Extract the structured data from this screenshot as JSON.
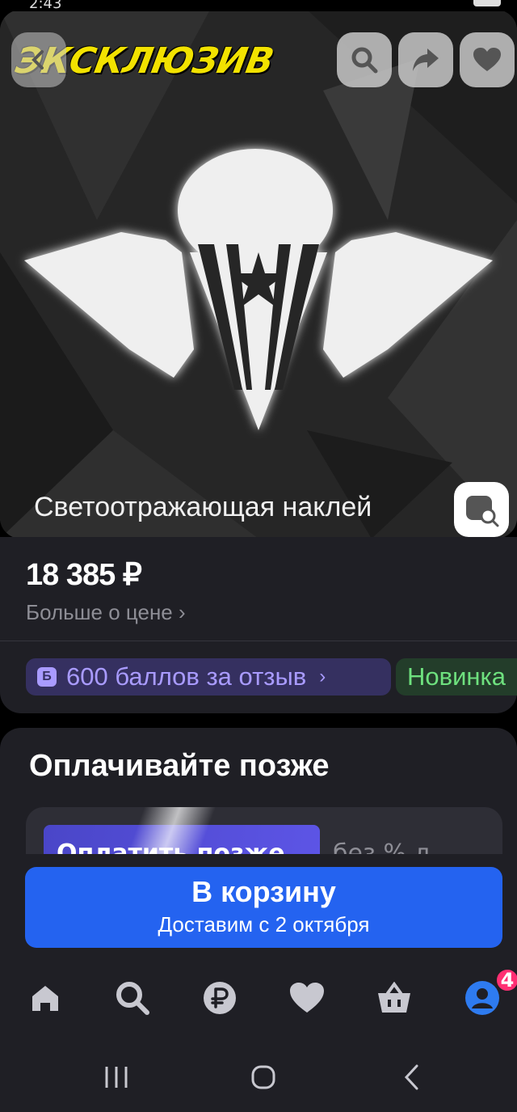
{
  "status_bar": {
    "time": "2:43"
  },
  "hero": {
    "exclusive_label": "ЭКСКЛЮЗИВ",
    "caption": "Светоотражающая наклей"
  },
  "price": {
    "value": "18 385 ₽",
    "more_label": "Больше о цене ›"
  },
  "chips": {
    "points_icon": "Б",
    "points_label": "600 баллов за отзыв",
    "points_chevron": "›",
    "new_label": "Новинка"
  },
  "pay_later": {
    "title": "Оплачивайте позже",
    "button_label": "Оплатить позже",
    "sub_label": "без % д"
  },
  "cart": {
    "title": "В корзину",
    "subtitle": "Доставим с 2 октября"
  },
  "tabs": {
    "profile_badge": "4"
  },
  "colors": {
    "accent": "#2463f0",
    "points": "#a99bff",
    "new": "#6ee07e",
    "badge": "#ff2f73"
  }
}
